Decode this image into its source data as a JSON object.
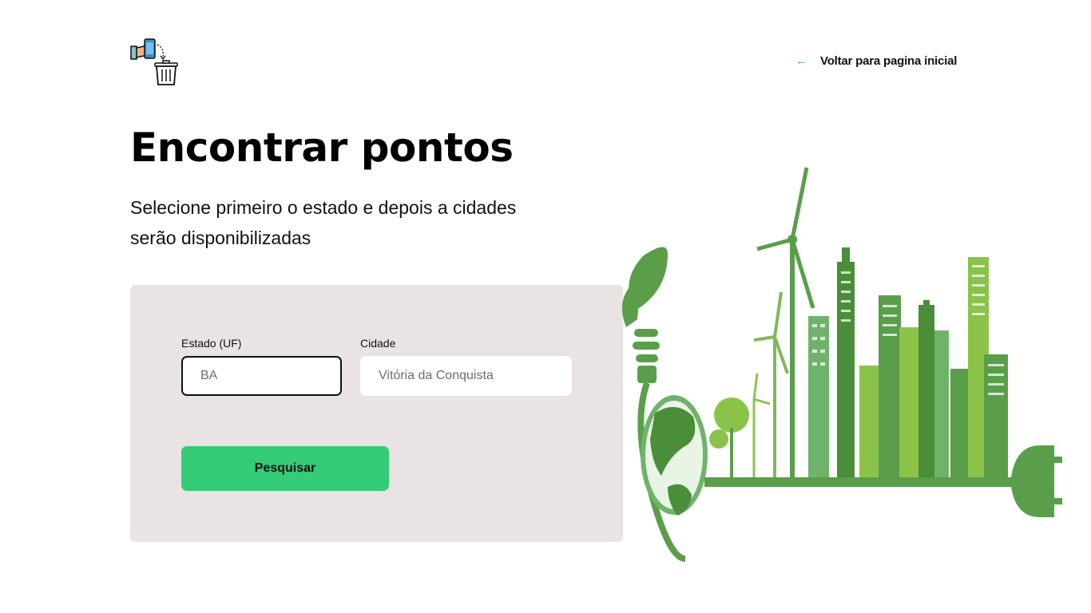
{
  "header": {
    "logo_name": "recycle-phone-logo",
    "back_link": {
      "icon": "arrow-left-icon",
      "label": "Voltar para pagina inicial"
    }
  },
  "main": {
    "title": "Encontrar pontos",
    "subtitle": "Selecione primeiro o estado e depois a cidades serão disponibilizadas"
  },
  "form": {
    "uf": {
      "label": "Estado (UF)",
      "placeholder": "BA",
      "value": ""
    },
    "city": {
      "label": "Cidade",
      "placeholder": "Vitória da Conquista",
      "value": ""
    },
    "submit_label": "Pesquisar"
  },
  "colors": {
    "accent": "#34cb79",
    "card_background": "#e9e4e3",
    "illustration_green": "#5a9e4a",
    "illustration_light_green": "#8bc34a"
  }
}
